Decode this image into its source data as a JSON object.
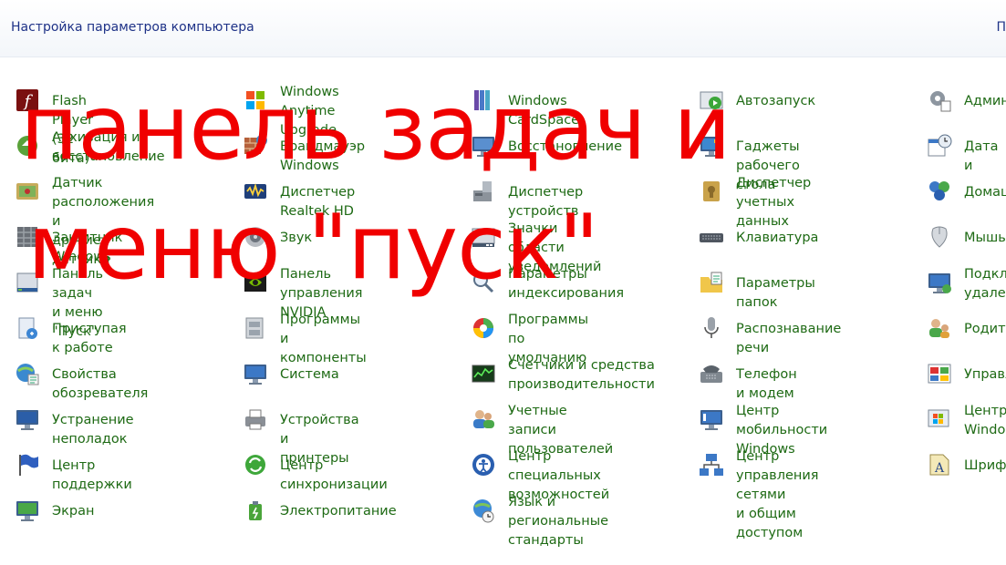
{
  "header": {
    "title": "Настройка параметров компьютера",
    "right_text": "П"
  },
  "overlay": {
    "line1": "панель задач и",
    "line2": "меню \"пуск\""
  },
  "columns": [
    [
      {
        "label": "Flash Player (32 бита)",
        "icon": "flash-player-icon"
      },
      {
        "label": "Архивация и\nвосстановление",
        "icon": "backup-icon"
      },
      {
        "label": "Датчик расположения и\nдругие датчики",
        "icon": "location-sensor-icon"
      },
      {
        "label": "Защитник Windows",
        "icon": "windows-defender-icon"
      },
      {
        "label": "Панель задач и меню\n\"Пуск\"",
        "icon": "taskbar-icon"
      },
      {
        "label": "Приступая к работе",
        "icon": "getting-started-icon"
      },
      {
        "label": "Свойства обозревателя",
        "icon": "internet-options-icon"
      },
      {
        "label": "Устранение неполадок",
        "icon": "troubleshooting-icon"
      },
      {
        "label": "Центр поддержки",
        "icon": "action-center-flag-icon"
      },
      {
        "label": "Экран",
        "icon": "display-icon"
      }
    ],
    [
      {
        "label": "Windows Anytime\nUpgrade",
        "icon": "windows-anytime-upgrade-icon"
      },
      {
        "label": "Брандмауэр Windows",
        "icon": "firewall-icon"
      },
      {
        "label": "Диспетчер Realtek HD",
        "icon": "realtek-hd-icon"
      },
      {
        "label": "Звук",
        "icon": "speaker-icon"
      },
      {
        "label": "Панель управления\nNVIDIA",
        "icon": "nvidia-icon"
      },
      {
        "label": "Программы и\nкомпоненты",
        "icon": "programs-icon"
      },
      {
        "label": "Система",
        "icon": "system-icon"
      },
      {
        "label": "Устройства и принтеры",
        "icon": "printer-icon"
      },
      {
        "label": "Центр синхронизации",
        "icon": "sync-center-icon"
      },
      {
        "label": "Электропитание",
        "icon": "power-options-icon"
      }
    ],
    [
      {
        "label": "Windows CardSpace",
        "icon": "cardspace-icon"
      },
      {
        "label": "Восстановление",
        "icon": "recovery-icon"
      },
      {
        "label": "Диспетчер устройств",
        "icon": "device-manager-icon"
      },
      {
        "label": "Значки области\nуведомлений",
        "icon": "notification-area-icon"
      },
      {
        "label": "Параметры\nиндексирования",
        "icon": "indexing-icon"
      },
      {
        "label": "Программы по\nумолчанию",
        "icon": "default-programs-icon"
      },
      {
        "label": "Счетчики и средства\nпроизводительности",
        "icon": "performance-icon"
      },
      {
        "label": "Учетные записи\nпользователей",
        "icon": "user-accounts-icon"
      },
      {
        "label": "Центр специальных\nвозможностей",
        "icon": "accessibility-icon"
      },
      {
        "label": "Язык и региональные\nстандарты",
        "icon": "region-language-icon"
      }
    ],
    [
      {
        "label": "Автозапуск",
        "icon": "autoplay-icon"
      },
      {
        "label": "Гаджеты рабочего стола",
        "icon": "gadgets-icon"
      },
      {
        "label": "Диспетчер учетных\nданных",
        "icon": "credential-manager-icon"
      },
      {
        "label": "Клавиатура",
        "icon": "keyboard-icon"
      },
      {
        "label": "Параметры папок",
        "icon": "folder-options-icon"
      },
      {
        "label": "Распознавание речи",
        "icon": "microphone-icon"
      },
      {
        "label": "Телефон и модем",
        "icon": "phone-modem-icon"
      },
      {
        "label": "Центр мобильности\nWindows",
        "icon": "mobility-center-icon"
      },
      {
        "label": "Центр управления сетями\nи общим доступом",
        "icon": "network-center-icon"
      },
      {
        "label": "",
        "icon": ""
      }
    ],
    [
      {
        "label": "Админ",
        "icon": "admin-tools-icon"
      },
      {
        "label": "Дата и",
        "icon": "date-time-icon"
      },
      {
        "label": "Домаш",
        "icon": "homegroup-icon"
      },
      {
        "label": "Мышь",
        "icon": "mouse-icon"
      },
      {
        "label": "Подкл\nудален",
        "icon": "remote-connection-icon"
      },
      {
        "label": "Родите",
        "icon": "parental-controls-icon"
      },
      {
        "label": "Управл",
        "icon": "management-icon"
      },
      {
        "label": "Центр\nWindo",
        "icon": "windows-update-icon"
      },
      {
        "label": "Шрифт",
        "icon": "fonts-icon"
      },
      {
        "label": "",
        "icon": ""
      }
    ]
  ]
}
